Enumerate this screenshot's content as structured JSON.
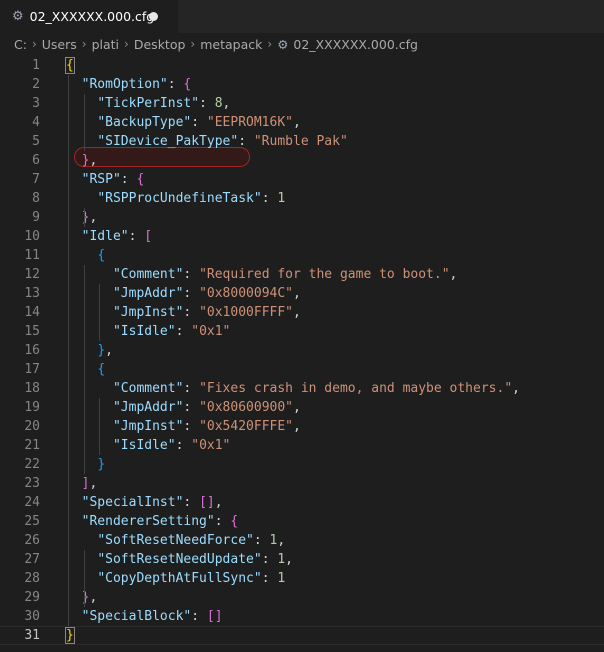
{
  "tab": {
    "filename": "02_XXXXXX.000.cfg",
    "modified": true
  },
  "breadcrumb": [
    "C:",
    "Users",
    "plati",
    "Desktop",
    "metapack",
    "02_XXXXXX.000.cfg"
  ],
  "editor": {
    "active_line": 31,
    "lines": [
      {
        "n": "1",
        "t": [
          [
            "{",
            "b1 match"
          ]
        ]
      },
      {
        "n": "2",
        "t": [
          [
            "  ",
            ""
          ],
          [
            "\"RomOption\"",
            "key"
          ],
          [
            ": ",
            ""
          ],
          [
            "{",
            "b2"
          ]
        ]
      },
      {
        "n": "3",
        "t": [
          [
            "    ",
            ""
          ],
          [
            "\"TickPerInst\"",
            "key"
          ],
          [
            ": ",
            ""
          ],
          [
            "8",
            "num"
          ],
          [
            ",",
            ""
          ]
        ]
      },
      {
        "n": "4",
        "t": [
          [
            "    ",
            ""
          ],
          [
            "\"BackupType\"",
            "key"
          ],
          [
            ": ",
            ""
          ],
          [
            "\"EEPROM16K\"",
            "str"
          ],
          [
            ",",
            ""
          ]
        ]
      },
      {
        "n": "5",
        "t": [
          [
            "    ",
            ""
          ],
          [
            "\"SIDevice_PakType\"",
            "key"
          ],
          [
            ": ",
            ""
          ],
          [
            "\"Rumble Pak\"",
            "str"
          ]
        ]
      },
      {
        "n": "6",
        "t": [
          [
            "  ",
            ""
          ],
          [
            "}",
            "b2"
          ],
          [
            ",",
            ""
          ]
        ]
      },
      {
        "n": "7",
        "t": [
          [
            "  ",
            ""
          ],
          [
            "\"RSP\"",
            "key"
          ],
          [
            ": ",
            ""
          ],
          [
            "{",
            "b2"
          ]
        ]
      },
      {
        "n": "8",
        "t": [
          [
            "    ",
            ""
          ],
          [
            "\"RSPProcUndefineTask\"",
            "key"
          ],
          [
            ": ",
            ""
          ],
          [
            "1",
            "num"
          ]
        ]
      },
      {
        "n": "9",
        "t": [
          [
            "  ",
            ""
          ],
          [
            "}",
            "b2"
          ],
          [
            ",",
            ""
          ]
        ]
      },
      {
        "n": "10",
        "t": [
          [
            "  ",
            ""
          ],
          [
            "\"Idle\"",
            "key"
          ],
          [
            ": ",
            ""
          ],
          [
            "[",
            "b2"
          ]
        ]
      },
      {
        "n": "11",
        "t": [
          [
            "    ",
            ""
          ],
          [
            "{",
            "b3"
          ]
        ]
      },
      {
        "n": "12",
        "t": [
          [
            "      ",
            ""
          ],
          [
            "\"Comment\"",
            "key"
          ],
          [
            ": ",
            ""
          ],
          [
            "\"Required for the game to boot.\"",
            "str"
          ],
          [
            ",",
            ""
          ]
        ]
      },
      {
        "n": "13",
        "t": [
          [
            "      ",
            ""
          ],
          [
            "\"JmpAddr\"",
            "key"
          ],
          [
            ": ",
            ""
          ],
          [
            "\"0x8000094C\"",
            "str"
          ],
          [
            ",",
            ""
          ]
        ]
      },
      {
        "n": "14",
        "t": [
          [
            "      ",
            ""
          ],
          [
            "\"JmpInst\"",
            "key"
          ],
          [
            ": ",
            ""
          ],
          [
            "\"0x1000FFFF\"",
            "str"
          ],
          [
            ",",
            ""
          ]
        ]
      },
      {
        "n": "15",
        "t": [
          [
            "      ",
            ""
          ],
          [
            "\"IsIdle\"",
            "key"
          ],
          [
            ": ",
            ""
          ],
          [
            "\"0x1\"",
            "str"
          ]
        ]
      },
      {
        "n": "16",
        "t": [
          [
            "    ",
            ""
          ],
          [
            "}",
            "b3"
          ],
          [
            ",",
            ""
          ]
        ]
      },
      {
        "n": "17",
        "t": [
          [
            "    ",
            ""
          ],
          [
            "{",
            "b3"
          ]
        ]
      },
      {
        "n": "18",
        "t": [
          [
            "      ",
            ""
          ],
          [
            "\"Comment\"",
            "key"
          ],
          [
            ": ",
            ""
          ],
          [
            "\"Fixes crash in demo, and maybe others.\"",
            "str"
          ],
          [
            ",",
            ""
          ]
        ]
      },
      {
        "n": "19",
        "t": [
          [
            "      ",
            ""
          ],
          [
            "\"JmpAddr\"",
            "key"
          ],
          [
            ": ",
            ""
          ],
          [
            "\"0x80600900\"",
            "str"
          ],
          [
            ",",
            ""
          ]
        ]
      },
      {
        "n": "20",
        "t": [
          [
            "      ",
            ""
          ],
          [
            "\"JmpInst\"",
            "key"
          ],
          [
            ": ",
            ""
          ],
          [
            "\"0x5420FFFE\"",
            "str"
          ],
          [
            ",",
            ""
          ]
        ]
      },
      {
        "n": "21",
        "t": [
          [
            "      ",
            ""
          ],
          [
            "\"IsIdle\"",
            "key"
          ],
          [
            ": ",
            ""
          ],
          [
            "\"0x1\"",
            "str"
          ]
        ]
      },
      {
        "n": "22",
        "t": [
          [
            "    ",
            ""
          ],
          [
            "}",
            "b3"
          ]
        ]
      },
      {
        "n": "23",
        "t": [
          [
            "  ",
            ""
          ],
          [
            "]",
            "b2"
          ],
          [
            ",",
            ""
          ]
        ]
      },
      {
        "n": "24",
        "t": [
          [
            "  ",
            ""
          ],
          [
            "\"SpecialInst\"",
            "key"
          ],
          [
            ": ",
            ""
          ],
          [
            "[]",
            "b2"
          ],
          [
            ",",
            ""
          ]
        ]
      },
      {
        "n": "25",
        "t": [
          [
            "  ",
            ""
          ],
          [
            "\"RendererSetting\"",
            "key"
          ],
          [
            ": ",
            ""
          ],
          [
            "{",
            "b2"
          ]
        ]
      },
      {
        "n": "26",
        "t": [
          [
            "    ",
            ""
          ],
          [
            "\"SoftResetNeedForce\"",
            "key"
          ],
          [
            ": ",
            ""
          ],
          [
            "1",
            "num"
          ],
          [
            ",",
            ""
          ]
        ]
      },
      {
        "n": "27",
        "t": [
          [
            "    ",
            ""
          ],
          [
            "\"SoftResetNeedUpdate\"",
            "key"
          ],
          [
            ": ",
            ""
          ],
          [
            "1",
            "num"
          ],
          [
            ",",
            ""
          ]
        ]
      },
      {
        "n": "28",
        "t": [
          [
            "    ",
            ""
          ],
          [
            "\"CopyDepthAtFullSync\"",
            "key"
          ],
          [
            ": ",
            ""
          ],
          [
            "1",
            "num"
          ]
        ]
      },
      {
        "n": "29",
        "t": [
          [
            "  ",
            ""
          ],
          [
            "}",
            "b2"
          ],
          [
            ",",
            ""
          ]
        ]
      },
      {
        "n": "30",
        "t": [
          [
            "  ",
            ""
          ],
          [
            "\"SpecialBlock\"",
            "key"
          ],
          [
            ": ",
            ""
          ],
          [
            "[]",
            "b2"
          ]
        ]
      },
      {
        "n": "31",
        "t": [
          [
            "}",
            "b1 match"
          ]
        ]
      }
    ]
  }
}
